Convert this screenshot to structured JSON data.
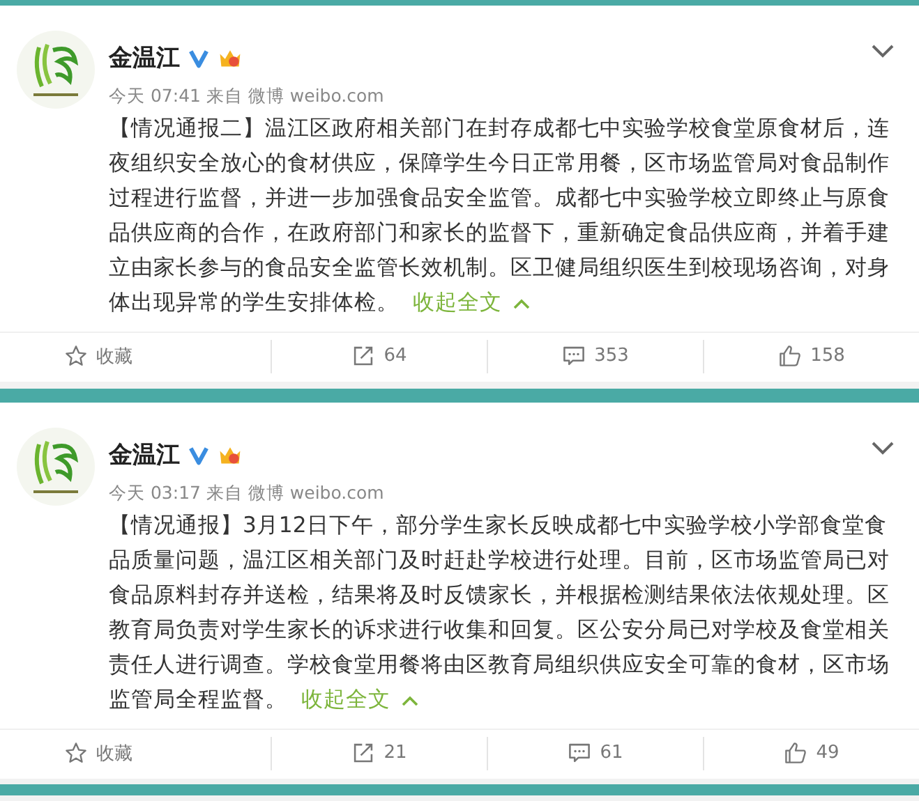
{
  "posts": [
    {
      "author": "金温江",
      "verified": true,
      "meta": "今天 07:41 来自 微博 weibo.com",
      "text": "【情况通报二】温江区政府相关部门在封存成都七中实验学校食堂原食材后，连夜组织安全放心的食材供应，保障学生今日正常用餐，区市场监管局对食品制作过程进行监督，并进一步加强食品安全监管。成都七中实验学校立即终止与原食品供应商的合作，在政府部门和家长的监督下，重新确定食品供应商，并着手建立由家长参与的食品安全监管长效机制。区卫健局组织医生到校现场咨询，对身体出现异常的学生安排体检。",
      "collapse_link": "收起全文",
      "actions": [
        {
          "kind": "favorite",
          "label": "收藏"
        },
        {
          "kind": "repost",
          "label": "64"
        },
        {
          "kind": "comment",
          "label": "353"
        },
        {
          "kind": "like",
          "label": "158"
        }
      ]
    },
    {
      "author": "金温江",
      "verified": true,
      "meta": "今天 03:17 来自 微博 weibo.com",
      "text": "【情况通报】3月12日下午，部分学生家长反映成都七中实验学校小学部食堂食品质量问题，温江区相关部门及时赶赴学校进行处理。目前，区市场监管局已对食品原料封存并送检，结果将及时反馈家长，并根据检测结果依法依规处理。区教育局负责对学生家长的诉求进行收集和回复。区公安分局已对学校及食堂相关责任人进行调查。学校食堂用餐将由区教育局组织供应安全可靠的食材，区市场监管局全程监督。",
      "collapse_link": "收起全文",
      "actions": [
        {
          "kind": "favorite",
          "label": "收藏"
        },
        {
          "kind": "repost",
          "label": "21"
        },
        {
          "kind": "comment",
          "label": "61"
        },
        {
          "kind": "like",
          "label": "49"
        }
      ]
    }
  ]
}
